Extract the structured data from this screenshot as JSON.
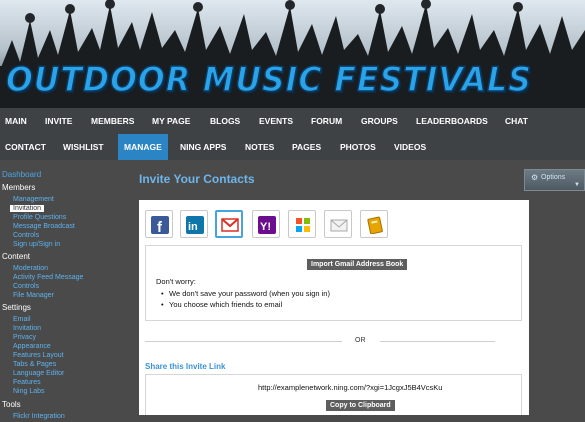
{
  "site": {
    "title": "OUTDOOR MUSIC FESTIVALS"
  },
  "nav": {
    "row1": [
      {
        "label": "MAIN"
      },
      {
        "label": "INVITE"
      },
      {
        "label": "MEMBERS"
      },
      {
        "label": "MY PAGE"
      },
      {
        "label": "BLOGS"
      },
      {
        "label": "EVENTS"
      },
      {
        "label": "FORUM"
      },
      {
        "label": "GROUPS"
      },
      {
        "label": "LEADERBOARDS"
      },
      {
        "label": "CHAT"
      }
    ],
    "row2": [
      {
        "label": "CONTACT"
      },
      {
        "label": "WISHLIST"
      },
      {
        "label": "MANAGE"
      },
      {
        "label": "NING APPS"
      },
      {
        "label": "NOTES"
      },
      {
        "label": "PAGES"
      },
      {
        "label": "PHOTOS"
      },
      {
        "label": "VIDEOS"
      }
    ]
  },
  "sidebar": {
    "dashboard": "Dashboard",
    "members": {
      "heading": "Members",
      "items": [
        "Management",
        "Invitation",
        "Profile Questions",
        "Message Broadcast",
        "Controls",
        "Sign up/Sign in"
      ]
    },
    "content": {
      "heading": "Content",
      "items": [
        "Moderation",
        "Activity Feed Message",
        "Controls",
        "File Manager"
      ]
    },
    "settings": {
      "heading": "Settings",
      "items": [
        "Email",
        "Invitation",
        "Privacy",
        "Appearance",
        "Features Layout",
        "Tabs & Pages",
        "Language Editor",
        "Features",
        "Ning Labs"
      ]
    },
    "tools": {
      "heading": "Tools",
      "items": [
        "Flickr Integration"
      ]
    }
  },
  "main": {
    "title": "Invite Your Contacts",
    "options_label": "Options",
    "services": [
      {
        "icon": "facebook-icon",
        "color": "#3b5998"
      },
      {
        "icon": "linkedin-icon",
        "color": "#0e76a8"
      },
      {
        "icon": "gmail-icon",
        "color": "#d93025"
      },
      {
        "icon": "yahoo-icon",
        "color": "#6b0d8c"
      },
      {
        "icon": "windows-live-icon",
        "color": "#1f8de0"
      },
      {
        "icon": "email-icon",
        "color": "#bdbdbd"
      },
      {
        "icon": "address-book-icon",
        "color": "#e8a400"
      }
    ],
    "import_button": "Import Gmail Address Book",
    "dont_worry": "Don't worry:",
    "bullets": [
      "We don't save your password (when you sign in)",
      "You choose which friends to email"
    ],
    "or": "OR",
    "share_title": "Share this Invite Link",
    "invite_url": "http://examplenetwork.ning.com/?xgi=1JcgxJ5B4VcsKu",
    "copy_button": "Copy to Clipboard"
  }
}
